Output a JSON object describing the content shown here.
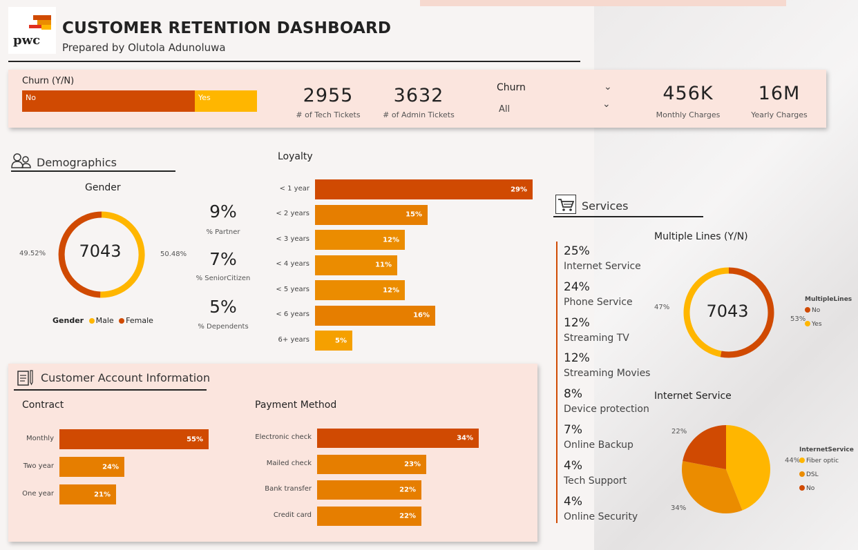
{
  "header": {
    "logo_text": "pwc",
    "title": "CUSTOMER RETENTION DASHBOARD",
    "subtitle": "Prepared by Olutola Adunoluwa"
  },
  "kpis": {
    "churn_label": "Churn (Y/N)",
    "churn_no_label": "No",
    "churn_yes_label": "Yes",
    "tech_tickets_value": "2955",
    "tech_tickets_label": "# of Tech Tickets",
    "admin_tickets_value": "3632",
    "admin_tickets_label": "# of Admin Tickets",
    "churn_slicer_title": "Churn",
    "churn_slicer_value": "All",
    "monthly_charges_value": "456K",
    "monthly_charges_label": "Monthly Charges",
    "yearly_charges_value": "16M",
    "yearly_charges_label": "Yearly Charges"
  },
  "demographics": {
    "section_title": "Demographics",
    "gender_title": "Gender",
    "gender_total": "7043",
    "female_pct_label": "49.52%",
    "male_pct_label": "50.48%",
    "legend_title": "Gender",
    "legend_male": "Male",
    "legend_female": "Female",
    "partner_value": "9%",
    "partner_label": "% Partner",
    "senior_value": "7%",
    "senior_label": "% SeniorCitizen",
    "dependents_value": "5%",
    "dependents_label": "% Dependents"
  },
  "loyalty": {
    "title": "Loyalty",
    "items": [
      {
        "label": "< 1 year",
        "pct": "29%",
        "value": 29
      },
      {
        "label": "< 2 years",
        "pct": "15%",
        "value": 15
      },
      {
        "label": "< 3 years",
        "pct": "12%",
        "value": 12
      },
      {
        "label": "< 4 years",
        "pct": "11%",
        "value": 11
      },
      {
        "label": "< 5 years",
        "pct": "12%",
        "value": 12
      },
      {
        "label": "< 6 years",
        "pct": "16%",
        "value": 16
      },
      {
        "label": "6+ years",
        "pct": "5%",
        "value": 5
      }
    ]
  },
  "account": {
    "section_title": "Customer Account Information",
    "contract_title": "Contract",
    "contract": [
      {
        "label": "Monthly",
        "pct": "55%",
        "value": 55
      },
      {
        "label": "Two year",
        "pct": "24%",
        "value": 24
      },
      {
        "label": "One year",
        "pct": "21%",
        "value": 21
      }
    ],
    "payment_title": "Payment Method",
    "payment": [
      {
        "label": "Electronic check",
        "pct": "34%",
        "value": 34
      },
      {
        "label": "Mailed check",
        "pct": "23%",
        "value": 23
      },
      {
        "label": "Bank transfer",
        "pct": "22%",
        "value": 22
      },
      {
        "label": "Credit card",
        "pct": "22%",
        "value": 22
      }
    ]
  },
  "services": {
    "section_title": "Services",
    "items": [
      {
        "pct": "25%",
        "label": "Internet Service"
      },
      {
        "pct": "24%",
        "label": "Phone Service"
      },
      {
        "pct": "12%",
        "label": "Streaming TV"
      },
      {
        "pct": "12%",
        "label": "Streaming Movies"
      },
      {
        "pct": "8%",
        "label": "Device protection"
      },
      {
        "pct": "7%",
        "label": "Online Backup"
      },
      {
        "pct": "4%",
        "label": "Tech Support"
      },
      {
        "pct": "4%",
        "label": "Online Security"
      }
    ]
  },
  "multiple_lines": {
    "title": "Multiple Lines (Y/N)",
    "total": "7043",
    "yes_pct_label": "47%",
    "no_pct_label": "53%",
    "legend_title": "MultipleLines",
    "legend_no": "No",
    "legend_yes": "Yes"
  },
  "internet_service": {
    "title": "Internet Service",
    "no_pct_label": "22%",
    "fiber_pct_label": "44%",
    "dsl_pct_label": "34%",
    "legend_title": "InternetService",
    "legend_fiber": "Fiber optic",
    "legend_dsl": "DSL",
    "legend_no": "No"
  },
  "colors": {
    "dark_orange": "#d04a02",
    "orange": "#e67e00",
    "mid_orange": "#eb8c00",
    "yellow": "#ffb600",
    "panel": "#fbe5de"
  },
  "chart_data": [
    {
      "type": "pie",
      "title": "Gender",
      "categories": [
        "Male",
        "Female"
      ],
      "values": [
        50.48,
        49.52
      ]
    },
    {
      "type": "bar",
      "title": "Loyalty",
      "categories": [
        "< 1 year",
        "< 2 years",
        "< 3 years",
        "< 4 years",
        "< 5 years",
        "< 6 years",
        "6+ years"
      ],
      "values": [
        29,
        15,
        12,
        11,
        12,
        16,
        5
      ]
    },
    {
      "type": "bar",
      "title": "Contract",
      "categories": [
        "Monthly",
        "Two year",
        "One year"
      ],
      "values": [
        55,
        24,
        21
      ]
    },
    {
      "type": "bar",
      "title": "Payment Method",
      "categories": [
        "Electronic check",
        "Mailed check",
        "Bank transfer",
        "Credit card"
      ],
      "values": [
        34,
        23,
        22,
        22
      ]
    },
    {
      "type": "pie",
      "title": "Multiple Lines (Y/N)",
      "categories": [
        "No",
        "Yes"
      ],
      "values": [
        53,
        47
      ]
    },
    {
      "type": "pie",
      "title": "Internet Service",
      "categories": [
        "Fiber optic",
        "DSL",
        "No"
      ],
      "values": [
        44,
        34,
        22
      ]
    }
  ]
}
